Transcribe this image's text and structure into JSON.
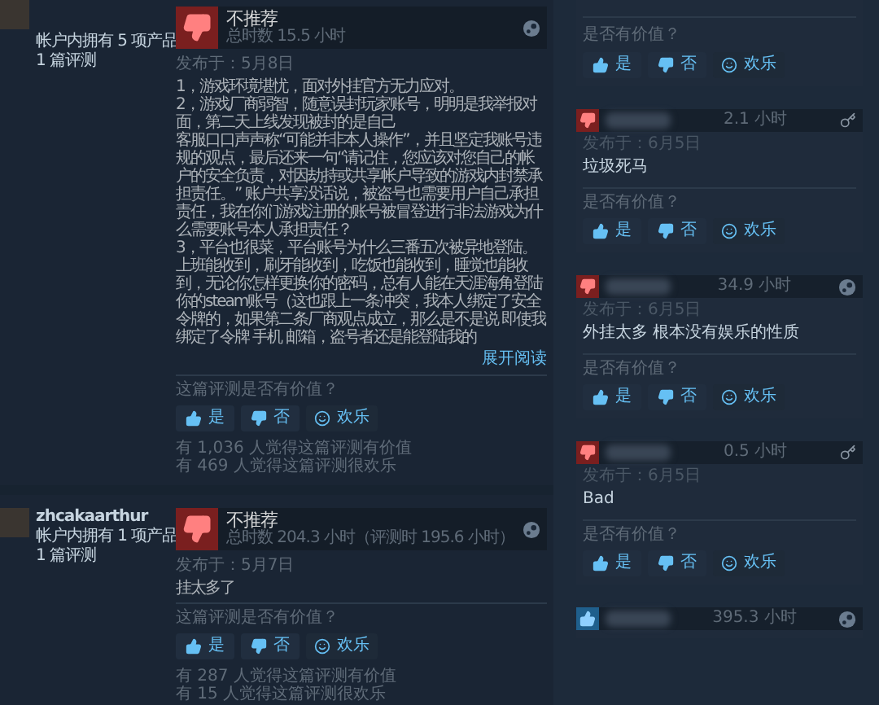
{
  "reviews": [
    {
      "products": "帐户内拥有 5 项产品",
      "review_count": "1 篇评测",
      "verdict": "不推荐",
      "recommended": false,
      "hours": "总时数 15.5 小时",
      "posted": "发布于：5月8日",
      "body": [
        "1，游戏环境堪忧，面对外挂官方无力应对。",
        "2，游戏厂商弱智，随意误封玩家账号，明明是我举报对面，第二天上线发现被封的是自己",
        "客服口口声声称“可能并非本人操作”，并且坚定我账号违规的观点，最后还来一句“请记住，您应该对您自己的帐户的安全负责，对因劫持或共享帐户导致的游戏内封禁承担责任。” 账户共享没话说，被盗号也需要用户自己承担责任，我在你们游戏注册的账号被冒登进行非法游戏为什么需要账号本人承担责任？",
        "3，平台也很菜，平台账号为什么三番五次被异地登陆。上班能收到，刷牙能收到，吃饭也能收到，睡觉也能收到，无论你怎样更换你的密码，总有人能在天涯海角登陆你的steam账号（这也跟上一条冲突，我本人绑定了安全令牌的，如果第二条厂商观点成立，那么是不是说 即使我绑定了令牌 手机 邮箱，盗号者还是能登陆我的"
      ],
      "expand": "展开阅读",
      "helpful_prompt": "这篇评测是否有价值？",
      "buttons": [
        {
          "kind": "yes",
          "label": "是"
        },
        {
          "kind": "no",
          "label": "否"
        },
        {
          "kind": "funny",
          "label": "欢乐"
        }
      ],
      "stats": [
        "有 1,036 人觉得这篇评测有价值",
        "有 469 人觉得这篇评测很欢乐"
      ]
    },
    {
      "author": "zhcakaarthur",
      "products": "帐户内拥有 1 项产品",
      "review_count": "1 篇评测",
      "verdict": "不推荐",
      "recommended": false,
      "hours": "总时数 204.3 小时（评测时 195.6 小时）",
      "posted": "发布于：5月7日",
      "body": [
        "挂太多了"
      ],
      "helpful_prompt": "这篇评测是否有价值？",
      "buttons": [
        {
          "kind": "yes",
          "label": "是"
        },
        {
          "kind": "no",
          "label": "否"
        },
        {
          "kind": "funny",
          "label": "欢乐"
        }
      ],
      "stats": [
        "有 287 人觉得这篇评测有价值",
        "有 15 人觉得这篇评测很欢乐"
      ]
    }
  ],
  "side_reviews": [
    {
      "kind": "footer",
      "helpful_prompt": "是否有价值？",
      "buttons": [
        {
          "kind": "yes",
          "label": "是"
        },
        {
          "kind": "no",
          "label": "否"
        },
        {
          "kind": "funny",
          "label": "欢乐"
        }
      ]
    },
    {
      "kind": "review",
      "recommended": false,
      "hours": "2.1 小时",
      "key_activated": true,
      "posted": "发布于：6月5日",
      "body": "垃圾死马",
      "helpful_prompt": "是否有价值？",
      "buttons": [
        {
          "kind": "yes",
          "label": "是"
        },
        {
          "kind": "no",
          "label": "否"
        },
        {
          "kind": "funny",
          "label": "欢乐"
        }
      ]
    },
    {
      "kind": "review",
      "recommended": false,
      "hours": "34.9 小时",
      "key_activated": false,
      "posted": "发布于：6月5日",
      "body": "外挂太多 根本没有娱乐的性质",
      "helpful_prompt": "是否有价值？",
      "buttons": [
        {
          "kind": "yes",
          "label": "是"
        },
        {
          "kind": "no",
          "label": "否"
        },
        {
          "kind": "funny",
          "label": "欢乐"
        }
      ]
    },
    {
      "kind": "review",
      "recommended": false,
      "hours": "0.5 小时",
      "key_activated": true,
      "posted": "发布于：6月5日",
      "body": "Bad",
      "helpful_prompt": "是否有价值？",
      "buttons": [
        {
          "kind": "yes",
          "label": "是"
        },
        {
          "kind": "no",
          "label": "否"
        },
        {
          "kind": "funny",
          "label": "欢乐"
        }
      ]
    },
    {
      "kind": "review",
      "recommended": true,
      "hours": "395.3 小时",
      "key_activated": false
    }
  ]
}
